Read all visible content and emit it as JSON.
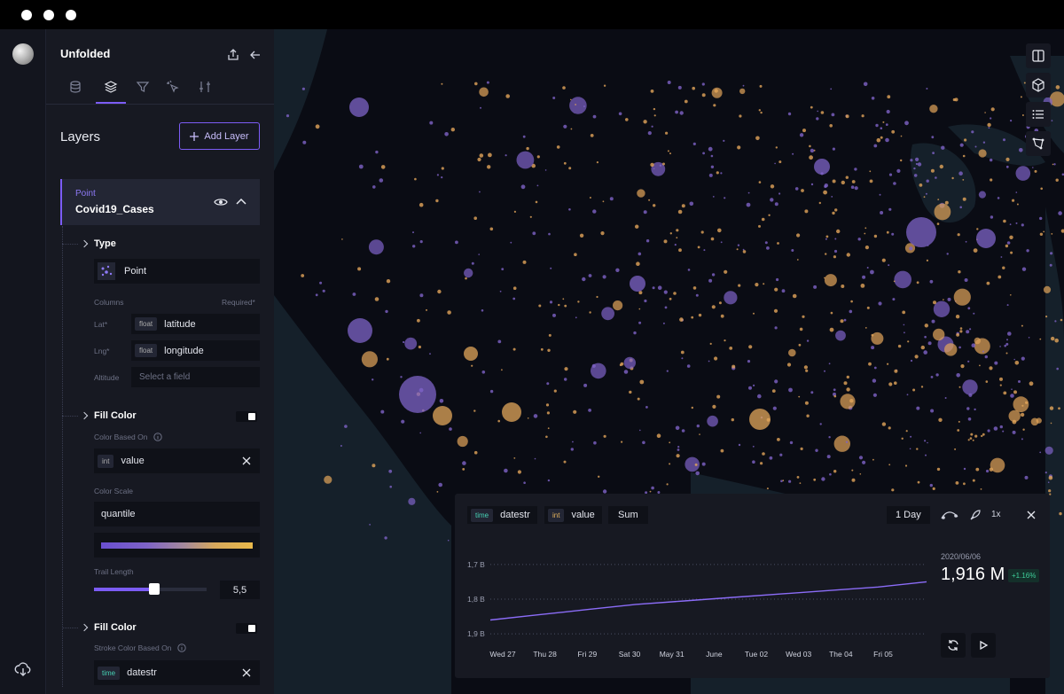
{
  "window": {
    "title": "Unfolded"
  },
  "tabs": [
    {
      "name": "data-icon"
    },
    {
      "name": "layers-icon",
      "active": true
    },
    {
      "name": "filter-icon"
    },
    {
      "name": "interactions-icon"
    },
    {
      "name": "map-settings-icon"
    }
  ],
  "layers_section": {
    "title": "Layers",
    "add_button": "Add Layer"
  },
  "layer": {
    "type_label": "Point",
    "name": "Covid19_Cases",
    "type_group": {
      "title": "Type",
      "value": "Point"
    },
    "columns": {
      "label": "Columns",
      "required_label": "Required*",
      "lat": {
        "label": "Lat*",
        "type": "float",
        "value": "latitude"
      },
      "lng": {
        "label": "Lng*",
        "type": "float",
        "value": "longitude"
      },
      "altitude": {
        "label": "Altitude",
        "placeholder": "Select a field"
      }
    },
    "fill_color": {
      "title": "Fill Color",
      "based_on_label": "Color Based On",
      "field_type": "int",
      "field": "value",
      "scale_label": "Color Scale",
      "scale": "quantile",
      "trail_label": "Trail Length",
      "trail_value": "5,5",
      "trail_fraction": 0.5
    },
    "stroke_color": {
      "title": "Fill Color",
      "based_on_label": "Stroke Color Based On",
      "field_type": "time",
      "field": "datestr"
    }
  },
  "timeline": {
    "field_type": "time",
    "field": "datestr",
    "value_type": "int",
    "value_field": "value",
    "aggregation": "Sum",
    "interval": "1 Day",
    "speed": "1x",
    "date": "2020/06/06",
    "current_value": "1,916 M",
    "delta": "+1.16%",
    "y_ticks": [
      "1,9 B",
      "1,8 B",
      "1,7 B"
    ]
  },
  "chart_data": {
    "type": "line",
    "x": [
      "Wed 27",
      "Thu 28",
      "Fri 29",
      "Sat 30",
      "May 31",
      "June",
      "Tue 02",
      "Wed 03",
      "The 04",
      "Fri 05"
    ],
    "series": [
      {
        "values": [
          1.74,
          1.755,
          1.77,
          1.785,
          1.795,
          1.805,
          1.815,
          1.825,
          1.835,
          1.85
        ]
      }
    ],
    "ylim": [
      1.68,
      1.92
    ],
    "y_ticks": [
      1.7,
      1.8,
      1.9
    ],
    "xlabel": "",
    "ylabel": "",
    "grid": true
  },
  "colors": {
    "accent": "#7c5cf5",
    "purple_point": "#7e63c7",
    "orange_point": "#e2a55a",
    "panel": "#171922",
    "map_bg": "#0a0c14"
  }
}
